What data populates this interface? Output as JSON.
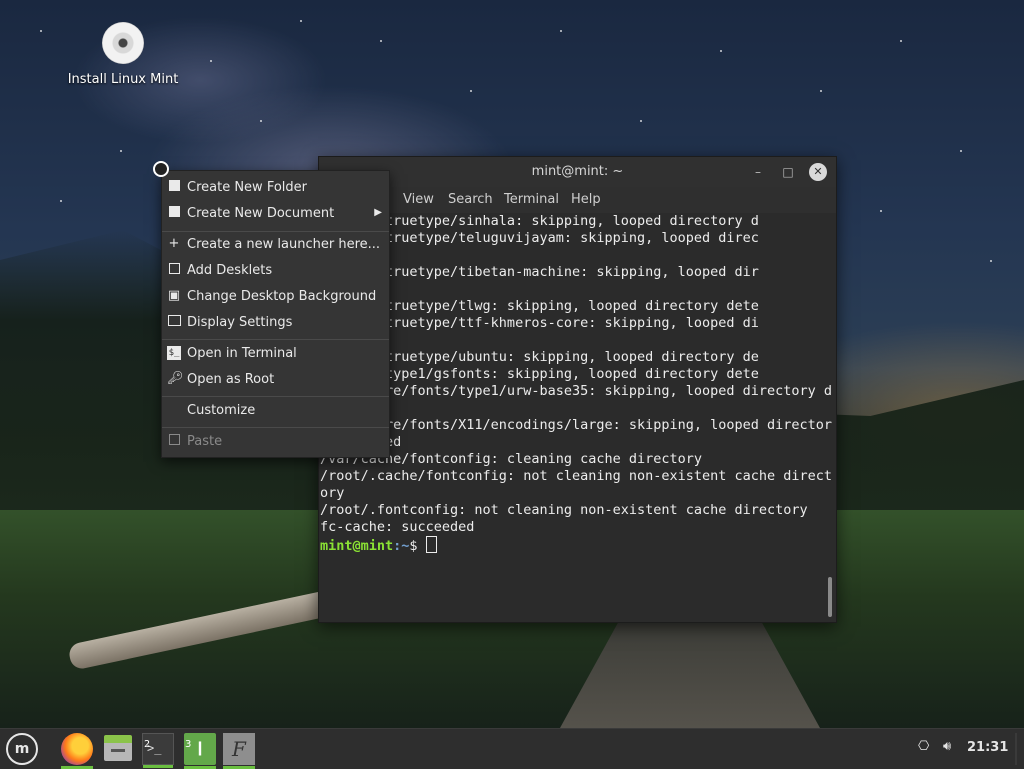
{
  "desktop": {
    "icons": [
      {
        "label": "Install Linux Mint",
        "icon": "disc-icon"
      }
    ]
  },
  "terminal": {
    "title": "mint@mint: ~",
    "menu": [
      "View",
      "Search",
      "Terminal",
      "Help"
    ],
    "lines": [
      "e/fonts/truetype/sinhala: skipping, looped directory d",
      "",
      "e/fonts/truetype/teluguvijayam: skipping, looped direc",
      "tected",
      "e/fonts/truetype/tibetan-machine: skipping, looped dir",
      "tected",
      "e/fonts/truetype/tlwg: skipping, looped directory dete",
      "",
      "e/fonts/truetype/ttf-khmeros-core: skipping, looped di",
      "etected",
      "e/fonts/truetype/ubuntu: skipping, looped directory de",
      "",
      "e/fonts/type1/gsfonts: skipping, looped directory dete",
      "",
      "/usr/share/fonts/type1/urw-base35: skipping, looped directory d",
      "etected",
      "/usr/share/fonts/X11/encodings/large: skipping, looped director",
      "y detected",
      "/var/cache/fontconfig: cleaning cache directory",
      "/root/.cache/fontconfig: not cleaning non-existent cache direct",
      "ory",
      "/root/.fontconfig: not cleaning non-existent cache directory",
      "fc-cache: succeeded"
    ],
    "prompt_user": "mint@mint",
    "prompt_path": ":~",
    "prompt_symbol": "$"
  },
  "context_menu": {
    "items": [
      {
        "label": "Create New Folder",
        "icon": "folder-add-icon"
      },
      {
        "label": "Create New Document",
        "icon": "document-add-icon",
        "submenu": true
      },
      {
        "label": "Create a new launcher here...",
        "icon": "plus-icon"
      },
      {
        "label": "Add Desklets",
        "icon": "desklet-icon"
      },
      {
        "label": "Change Desktop Background",
        "icon": "image-icon"
      },
      {
        "label": "Display Settings",
        "icon": "monitor-icon"
      },
      {
        "label": "Open in Terminal",
        "icon": "terminal-icon"
      },
      {
        "label": "Open as Root",
        "icon": "key-icon"
      },
      {
        "label": "Customize",
        "icon": ""
      },
      {
        "label": "Paste",
        "icon": "clipboard-icon",
        "disabled": true
      }
    ]
  },
  "panel": {
    "clock": "21:31",
    "workspace_badges": [
      "2",
      "3"
    ],
    "launchers": [
      "mint-menu-icon",
      "firefox-icon",
      "files-icon",
      "terminal-icon",
      "archive-icon",
      "font-viewer-icon"
    ],
    "tray": [
      "network-icon",
      "volume-icon"
    ]
  }
}
